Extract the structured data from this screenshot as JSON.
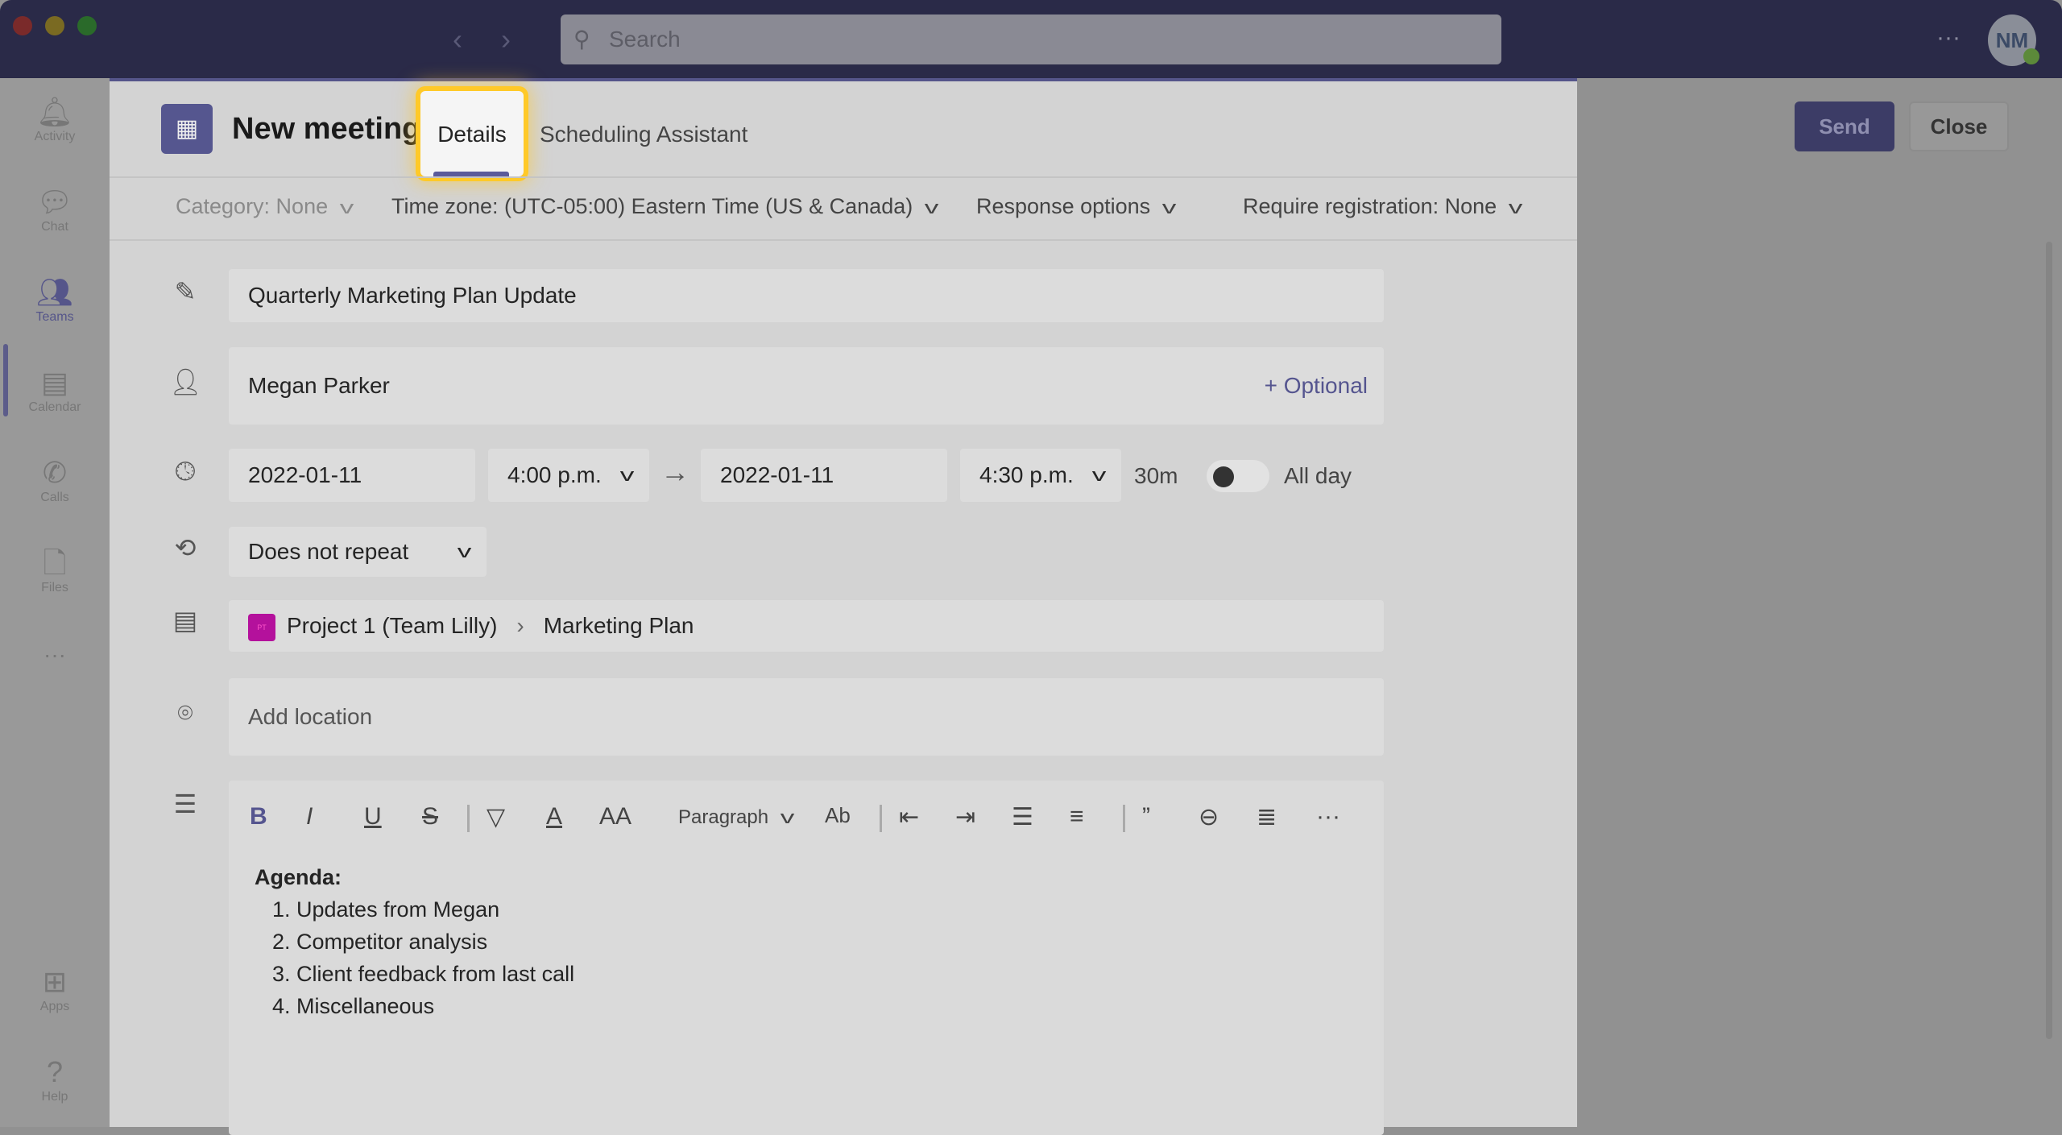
{
  "window": {
    "search_placeholder": "Search",
    "avatar_initials": "NM",
    "more": "···"
  },
  "sidebar": {
    "items": [
      {
        "label": "Activity",
        "icon": "bell-icon"
      },
      {
        "label": "Chat",
        "icon": "chat-icon"
      },
      {
        "label": "Teams",
        "icon": "teams-icon"
      },
      {
        "label": "Calendar",
        "icon": "calendar-icon"
      },
      {
        "label": "Calls",
        "icon": "phone-icon"
      },
      {
        "label": "Files",
        "icon": "file-icon"
      },
      {
        "label": "···",
        "icon": "more-icon"
      },
      {
        "label": "Apps",
        "icon": "apps-icon"
      },
      {
        "label": "Help",
        "icon": "help-icon"
      }
    ]
  },
  "actions": {
    "send": "Send",
    "close": "Close"
  },
  "modal": {
    "title": "New meeting",
    "tabs": [
      "Details",
      "Scheduling Assistant"
    ],
    "filters": {
      "category": "Category: None",
      "timezone": "Time zone: (UTC-05:00) Eastern Time (US & Canada)",
      "response": "Response options",
      "registration": "Require registration: None"
    },
    "title_value": "Quarterly Marketing Plan Update",
    "attendee": "Megan Parker",
    "optional": "+ Optional",
    "start_date": "2022-01-11",
    "start_time": "4:00 p.m.",
    "end_date": "2022-01-11",
    "end_time": "4:30 p.m.",
    "duration": "30m",
    "all_day": "All day",
    "all_day_on": false,
    "repeat": "Does not repeat",
    "channel_badge": "PT",
    "channel_team": "Project 1 (Team Lilly)",
    "channel_name": "Marketing Plan",
    "location_placeholder": "Add location",
    "editor": {
      "paragraph": "Paragraph",
      "heading": "Agenda:",
      "items": [
        "Updates from Megan",
        "Competitor analysis",
        "Client feedback from last call",
        "Miscellaneous"
      ]
    }
  }
}
